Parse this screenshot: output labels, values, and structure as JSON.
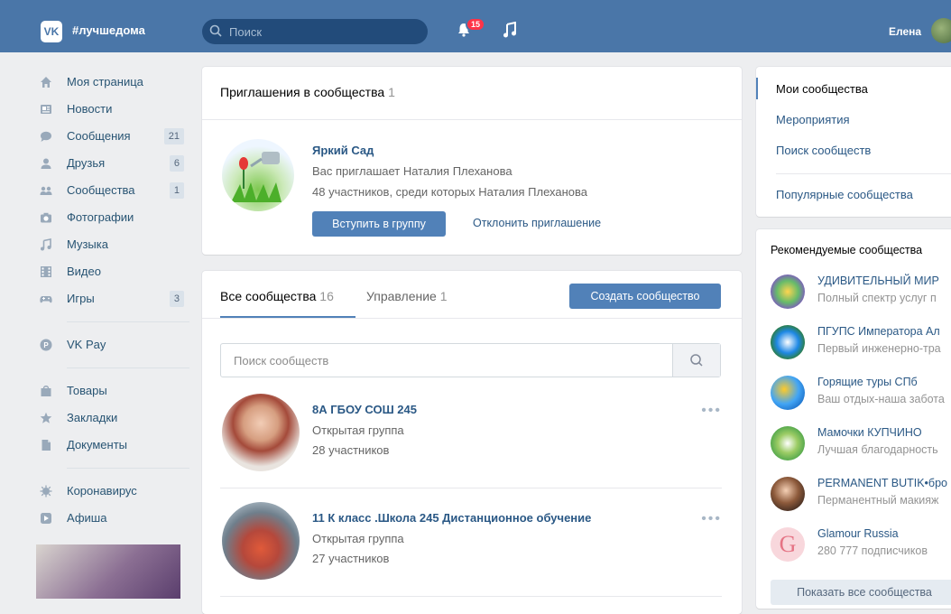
{
  "header": {
    "logo_text": "VK",
    "hashtag": "#лучшедома",
    "search_placeholder": "Поиск",
    "notifications_count": "15",
    "user_name": "Елена"
  },
  "sidebar": {
    "items": [
      {
        "label": "Моя страница",
        "count": ""
      },
      {
        "label": "Новости",
        "count": ""
      },
      {
        "label": "Сообщения",
        "count": "21"
      },
      {
        "label": "Друзья",
        "count": "6"
      },
      {
        "label": "Сообщества",
        "count": "1"
      },
      {
        "label": "Фотографии",
        "count": ""
      },
      {
        "label": "Музыка",
        "count": ""
      },
      {
        "label": "Видео",
        "count": ""
      },
      {
        "label": "Игры",
        "count": "3"
      }
    ],
    "vkpay": "VK Pay",
    "items2": [
      "Товары",
      "Закладки",
      "Документы"
    ],
    "items3": [
      "Коронавирус",
      "Афиша"
    ]
  },
  "invitations": {
    "title": "Приглашения в сообщества",
    "count": "1",
    "group_name": "Яркий Сад",
    "invited_by": "Вас приглашает Наталия Плеханова",
    "members": "48 участников, среди которых Наталия Плеханова",
    "join_label": "Вступить в группу",
    "decline_label": "Отклонить приглашение"
  },
  "communities": {
    "tab_all": "Все сообщества",
    "tab_all_count": "16",
    "tab_manage": "Управление",
    "tab_manage_count": "1",
    "create_label": "Создать сообщество",
    "search_placeholder": "Поиск сообществ",
    "rows": [
      {
        "name": "8А ГБОУ СОШ 245",
        "type": "Открытая группа",
        "members": "28 участников"
      },
      {
        "name": "11 К класс .Школа 245 Дистанционное обучение",
        "type": "Открытая группа",
        "members": "27 участников"
      }
    ]
  },
  "right_menu": {
    "items": [
      "Мои сообщества",
      "Мероприятия",
      "Поиск сообществ",
      "Популярные сообщества"
    ]
  },
  "recommended": {
    "title": "Рекомендуемые сообщества",
    "items": [
      {
        "name": "УДИВИТЕЛЬНЫЙ МИР",
        "desc": "Полный спектр услуг п"
      },
      {
        "name": "ПГУПС Императора Ал",
        "desc": "Первый инженерно-тра"
      },
      {
        "name": "Горящие туры СПб",
        "desc": "Ваш отдых-наша забота"
      },
      {
        "name": "Мамочки КУПЧИНО",
        "desc": "Лучшая благодарность"
      },
      {
        "name": "PERMANENT BUTIK•бро",
        "desc": "Перманентный макияж"
      },
      {
        "name": "Glamour Russia",
        "desc": "280 777 подписчиков"
      }
    ],
    "show_all_label": "Показать все сообщества"
  }
}
